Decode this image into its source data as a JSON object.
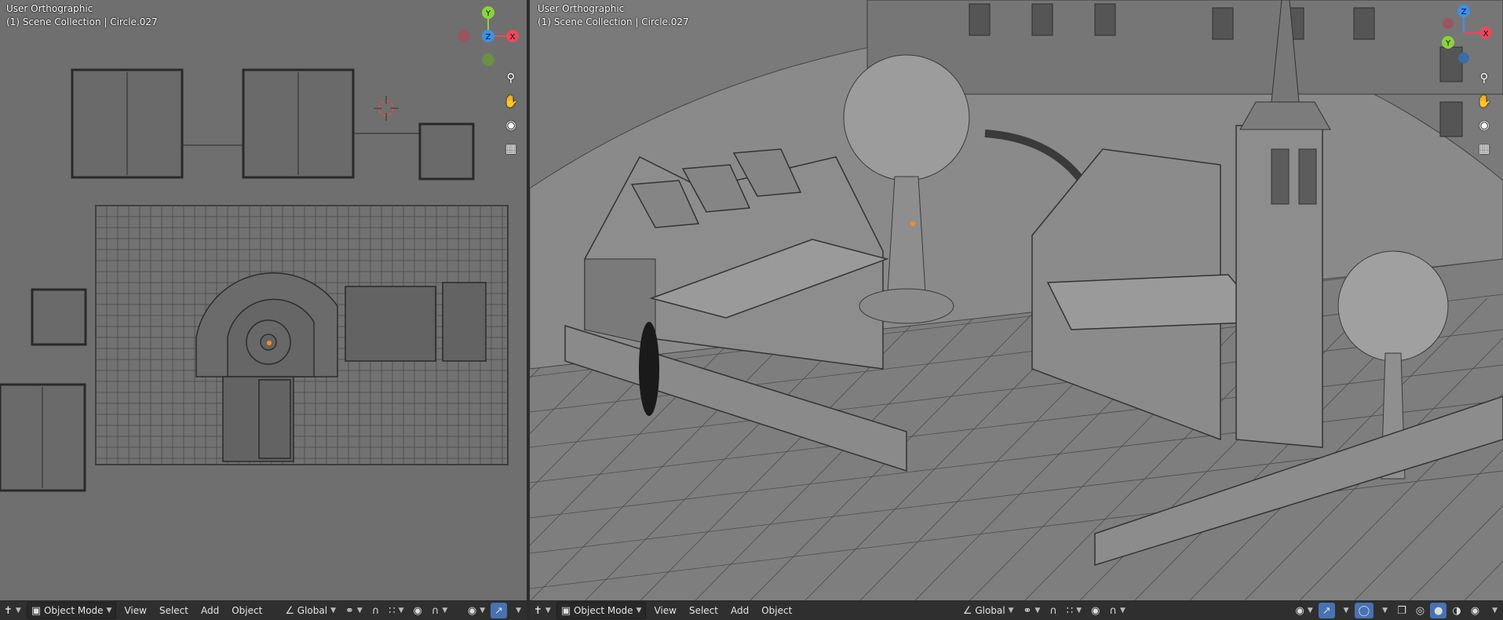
{
  "left_viewport": {
    "view_name": "User Orthographic",
    "collection_info": "(1) Scene Collection | Circle.027",
    "gizmo": {
      "axis_y": "Y",
      "axis_x": "X",
      "axis_z": "Z"
    },
    "nav_icons": [
      "zoom-icon",
      "hand-pan-icon",
      "camera-icon",
      "grid-icon"
    ],
    "header": {
      "editor_type_icon": "axes-icon",
      "mode_label": "Object Mode",
      "menus": [
        "View",
        "Select",
        "Add",
        "Object"
      ],
      "transform_orientation": "Global"
    }
  },
  "right_viewport": {
    "view_name": "User Orthographic",
    "collection_info": "(1) Scene Collection | Circle.027",
    "gizmo": {
      "axis_y": "Y",
      "axis_x": "X",
      "axis_z": "Z"
    },
    "nav_icons": [
      "zoom-icon",
      "hand-pan-icon",
      "camera-icon",
      "grid-icon"
    ],
    "header": {
      "editor_type_icon": "axes-icon",
      "mode_label": "Object Mode",
      "menus": [
        "View",
        "Select",
        "Add",
        "Object"
      ],
      "transform_orientation": "Global",
      "shading_modes": [
        "wireframe",
        "solid",
        "material",
        "rendered"
      ],
      "active_shading": "solid"
    }
  },
  "colors": {
    "axis_x": "#e8495d",
    "axis_y": "#8bd33d",
    "axis_z": "#3f8fe8",
    "header_bg": "#2f2f2f",
    "active_button": "#4772b3",
    "viewport_bg": "#6f6f6f"
  }
}
